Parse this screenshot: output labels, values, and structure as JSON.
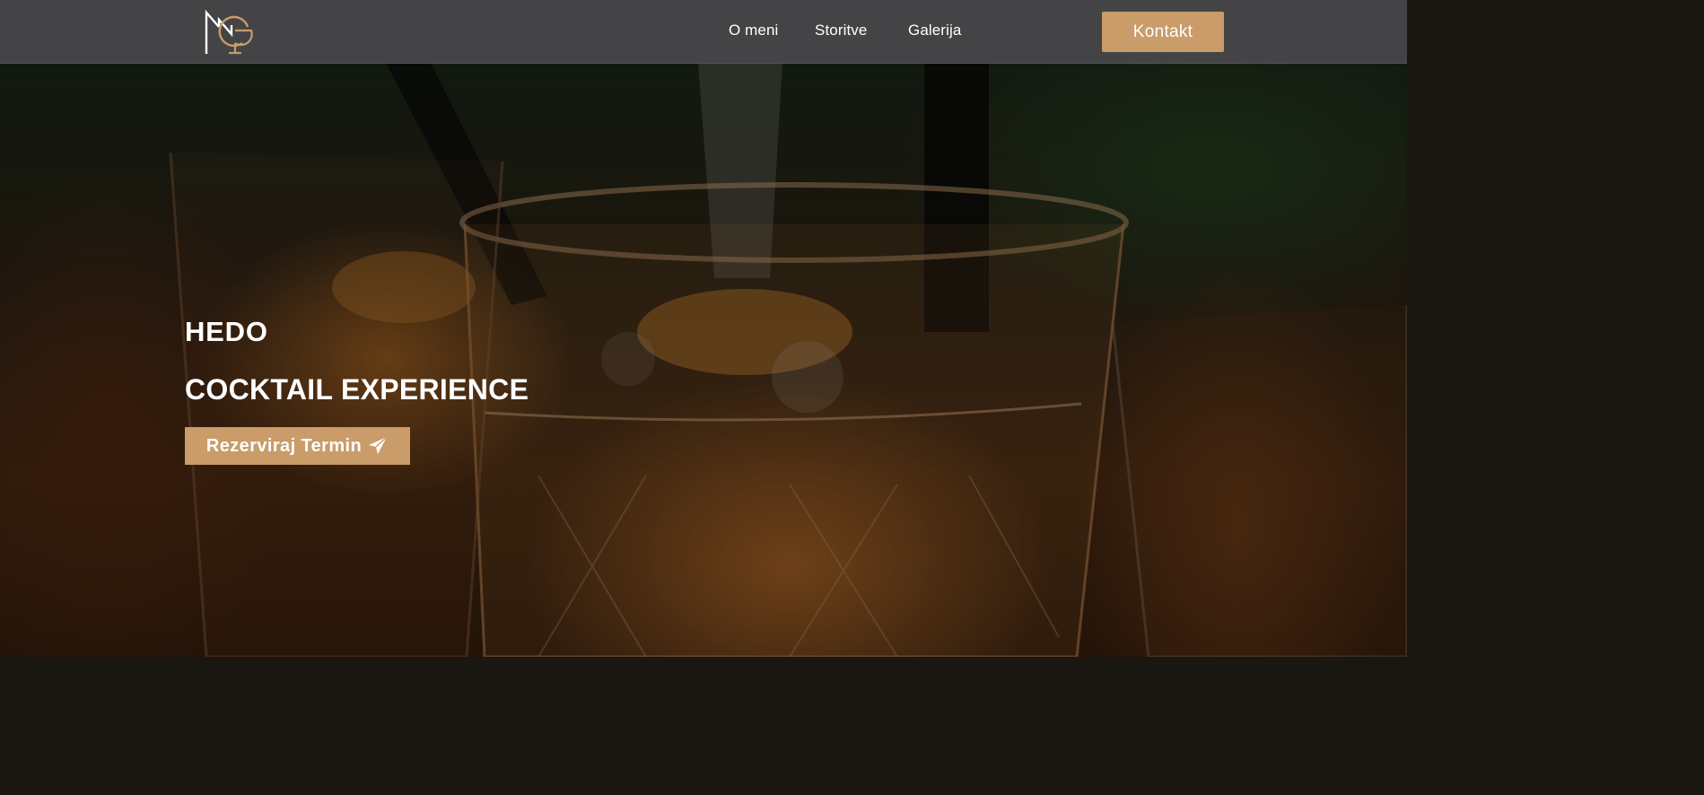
{
  "brand": {
    "logo_name": "hedo-logo",
    "accent": "#c99c6a"
  },
  "nav": {
    "links": [
      {
        "label": "O meni"
      },
      {
        "label": "Storitve"
      },
      {
        "label": "Galerija"
      }
    ],
    "contact_label": "Kontakt"
  },
  "hero": {
    "title": "HEDO",
    "subtitle": "COCKTAIL EXPERIENCE",
    "cta_label": "Rezerviraj Termin",
    "cta_icon": "paper-plane-icon"
  }
}
